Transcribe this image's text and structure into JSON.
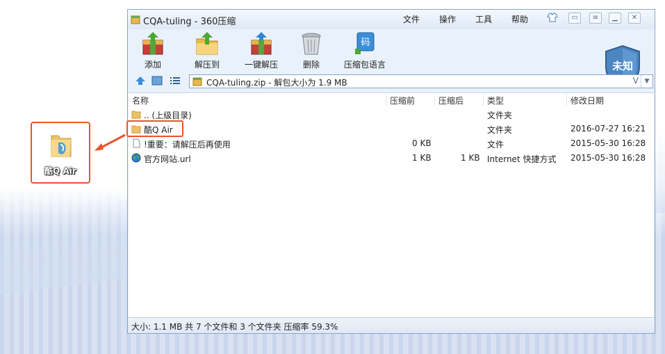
{
  "window": {
    "title": "CQA-tuling - 360压缩",
    "menu": [
      "文件",
      "操作",
      "工具",
      "帮助"
    ]
  },
  "toolbar": {
    "buttons": [
      {
        "label": "添加",
        "icon": "add-books-icon"
      },
      {
        "label": "解压到",
        "icon": "extract-to-folder-icon"
      },
      {
        "label": "一键解压",
        "icon": "one-click-extract-icon"
      },
      {
        "label": "删除",
        "icon": "trash-icon"
      },
      {
        "label": "压缩包语言",
        "icon": "archive-language-icon"
      }
    ],
    "shield_label": "未知"
  },
  "address": {
    "path": "CQA-tuling.zip - 解包大小为 1.9 MB"
  },
  "list": {
    "columns": [
      "名称",
      "压缩前",
      "压缩后",
      "类型",
      "修改日期"
    ],
    "rows": [
      {
        "name": ".. (上级目录)",
        "before": "",
        "after": "",
        "type": "文件夹",
        "date": "",
        "icon": "folder-icon"
      },
      {
        "name": "酷Q Air",
        "before": "",
        "after": "",
        "type": "文件夹",
        "date": "2016-07-27 16:21",
        "icon": "folder-icon"
      },
      {
        "name": "!重要：请解压后再使用",
        "before": "0 KB",
        "after": "",
        "type": "文件",
        "date": "2015-05-30 16:28",
        "icon": "file-icon"
      },
      {
        "name": "官方网站.url",
        "before": "1 KB",
        "after": "1 KB",
        "type": "Internet 快捷方式",
        "date": "2015-05-30 16:28",
        "icon": "globe-icon"
      }
    ]
  },
  "status": {
    "text": "大小: 1.1 MB 共 7 个文件和 3 个文件夹 压缩率 59.3%"
  },
  "desktop": {
    "icon_label": "酷Q Air"
  },
  "colors": {
    "highlight": "#e8542b",
    "window_border": "#8aa6c8",
    "window_bg": "#e9f1fb"
  }
}
